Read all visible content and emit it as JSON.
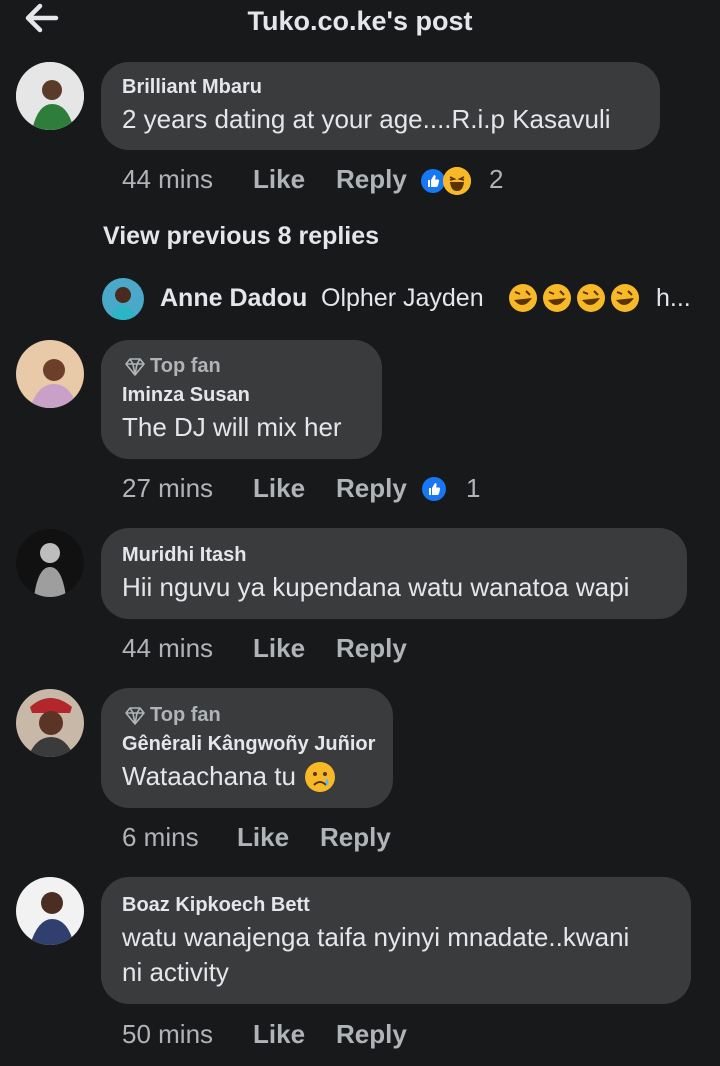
{
  "header": {
    "title": "Tuko.co.ke's post",
    "back_icon": "arrow-left-icon"
  },
  "comments": [
    {
      "name": "Brilliant Mbaru",
      "text": "2 years dating at your age....R.i.p Kasavuli",
      "time": "44 mins",
      "like": "Like",
      "reply": "Reply",
      "reaction_count": "2"
    },
    {
      "name": "Iminza Susan",
      "badge": "Top fan",
      "text": "The DJ will mix her",
      "time": "27 mins",
      "like": "Like",
      "reply": "Reply",
      "reaction_count": "1"
    },
    {
      "name": "Muridhi Itash",
      "text": "Hii nguvu ya kupendana watu wanatoa wapi",
      "time": "44 mins",
      "like": "Like",
      "reply": "Reply"
    },
    {
      "name": "Gênêrali Kângwoñy Juñior",
      "badge": "Top fan",
      "text": "Wataachana tu",
      "time": "6 mins",
      "like": "Like",
      "reply": "Reply"
    },
    {
      "name": "Boaz Kipkoech Bett",
      "text_lines": [
        "watu wanajenga taifa nyinyi mnadate..kwani",
        "ni activity"
      ],
      "time": "50 mins",
      "like": "Like",
      "reply": "Reply"
    }
  ],
  "replies": {
    "view_previous": "View previous 8 replies",
    "latest_reply": {
      "name": "Anne Dadou",
      "text": "Olpher Jayden",
      "more": "h..."
    }
  },
  "colors": {
    "background": "#18191a",
    "bubble": "#3a3b3c",
    "text": "#e4e6eb",
    "muted": "#b0b3b8",
    "like_blue": "#1877f2",
    "emoji_yellow": "#f7b928"
  }
}
